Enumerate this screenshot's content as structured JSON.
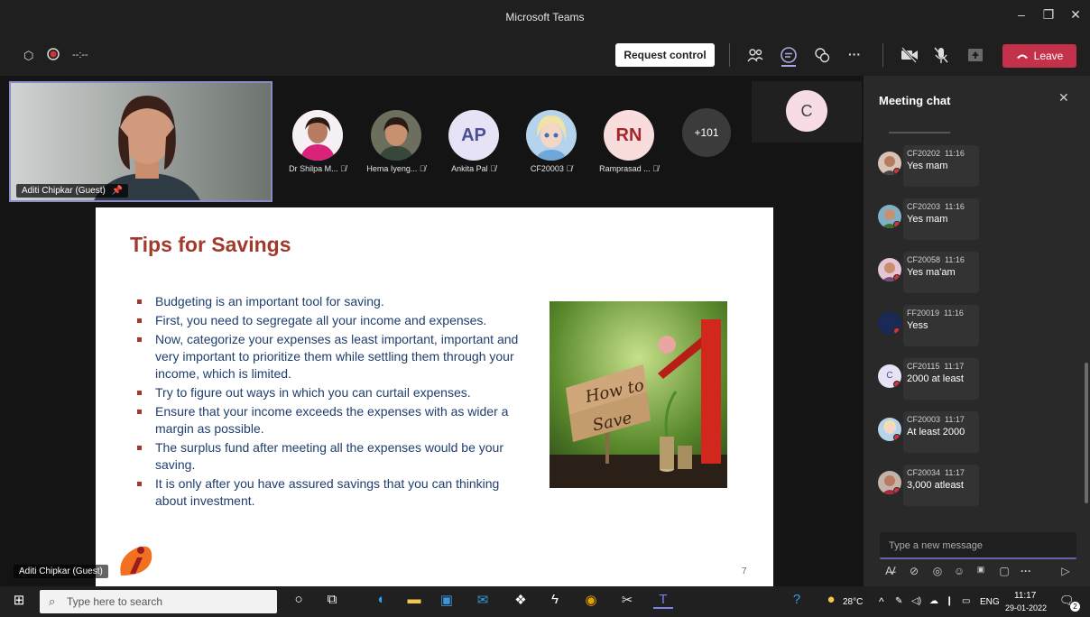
{
  "window": {
    "title": "Microsoft Teams"
  },
  "toolbar": {
    "timer": "--:--",
    "request_control": "Request control",
    "leave": "Leave"
  },
  "self_video": {
    "name": "Aditi Chipkar (Guest)"
  },
  "participants": [
    {
      "name": "Dr Shilpa M...",
      "avatar": "photo"
    },
    {
      "name": "Hema Iyeng...",
      "avatar": "photo"
    },
    {
      "name": "Ankita Pal",
      "initials": "AP",
      "color": "#e6e3f6"
    },
    {
      "name": "CF20003",
      "avatar": "photo"
    },
    {
      "name": "Ramprasad ...",
      "initials": "RN",
      "color": "#f9dcdc"
    }
  ],
  "more_participants": "+101",
  "extra_tile": {
    "initials": "C"
  },
  "slide": {
    "title": "Tips for Savings",
    "bullets": [
      "Budgeting is an important tool for saving.",
      "First, you need to segregate all your income and expenses.",
      "Now, categorize your expenses as least important, important and very important to prioritize them while settling them through your income, which is limited.",
      "Try to figure out ways in which you can curtail expenses.",
      "Ensure that your income exceeds the expenses with as wider a margin as possible.",
      "The surplus fund after meeting all the expenses would be your saving.",
      "It is only after you have assured savings that you can thinking about investment."
    ],
    "image_sign": [
      "How to",
      "Save"
    ],
    "page_number": "7"
  },
  "speaker_tag": "Aditi Chipkar (Guest)",
  "chat": {
    "title": "Meeting chat",
    "messages": [
      {
        "sender": "CF20202",
        "time": "11:16",
        "text": "Yes mam"
      },
      {
        "sender": "CF20203",
        "time": "11:16",
        "text": "Yes mam"
      },
      {
        "sender": "CF20058",
        "time": "11:16",
        "text": "Yes ma'am"
      },
      {
        "sender": "FF20019",
        "time": "11:16",
        "text": "Yess"
      },
      {
        "sender": "CF20115",
        "time": "11:17",
        "text": "2000 at least",
        "initial": "C"
      },
      {
        "sender": "CF20003",
        "time": "11:17",
        "text": "At least 2000"
      },
      {
        "sender": "CF20034",
        "time": "11:17",
        "text": "3,000 atleast"
      }
    ],
    "compose_placeholder": "Type a new message"
  },
  "taskbar": {
    "search_placeholder": "Type here to search",
    "temperature": "28°C",
    "language": "ENG",
    "time": "11:17",
    "date": "29-01-2022",
    "notifications": "2"
  },
  "colors": {
    "accent": "#6264a7",
    "leave": "#c4314b",
    "slide_title": "#a23a2c",
    "slide_text": "#1f3e6d"
  }
}
